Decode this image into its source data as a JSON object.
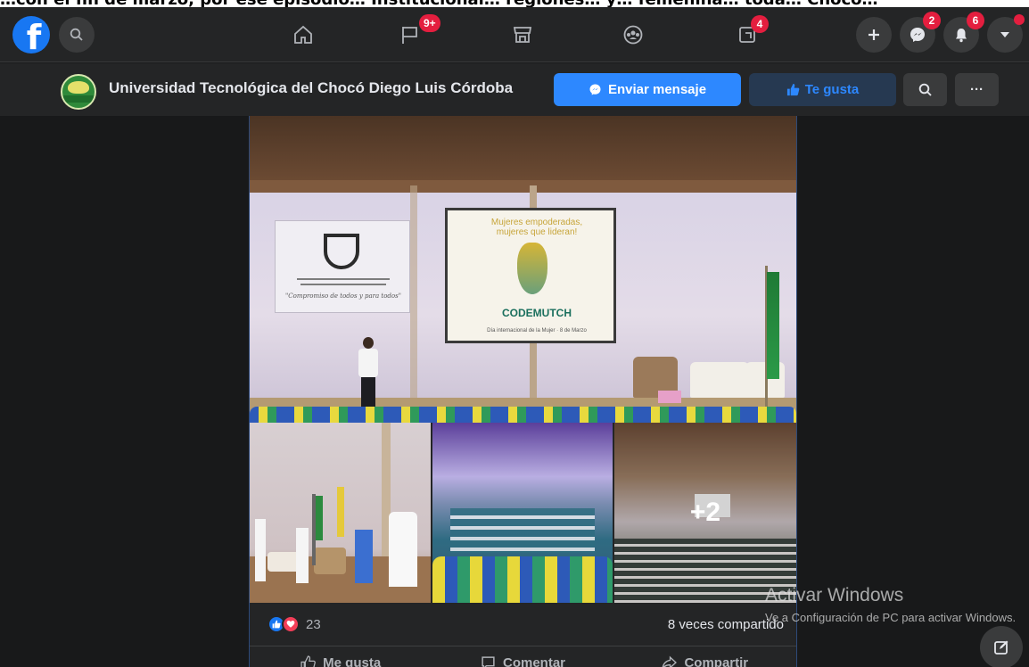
{
  "overlay_caption": "…con el fin de marzo, por ese episodio… Institucional… regiones… y… femenina… toda… Chocó…",
  "top_nav": {
    "badges": {
      "pages": "9+",
      "gaming": "4",
      "messenger": "2",
      "notifications": "6"
    }
  },
  "page_header": {
    "page_name": "Universidad Tecnológica del Chocó Diego Luis Córdoba",
    "send_message_label": "Enviar mensaje",
    "liked_label": "Te gusta",
    "more_label": "···"
  },
  "post": {
    "more_photos": "+2",
    "slides": {
      "screen_title": "Mujeres empoderadas, mujeres que lideran!",
      "screen_brand": "CODEMUTCH",
      "screen_footer": "Día internacional de la Mujer · 8 de Marzo",
      "banner_motto": "\"Compromiso de todos y para todos\""
    },
    "reaction_count": "23",
    "shares_text": "8 veces compartido",
    "actions": {
      "like": "Me gusta",
      "comment": "Comentar",
      "share": "Compartir"
    }
  },
  "windows_watermark": {
    "title": "Activar Windows",
    "subtitle": "Ve a Configuración de PC para activar Windows."
  },
  "colors": {
    "brand_blue": "#1877f2",
    "primary_button": "#2d88ff",
    "badge_red": "#e41e3f",
    "surface": "#242526",
    "background": "#18191a"
  }
}
